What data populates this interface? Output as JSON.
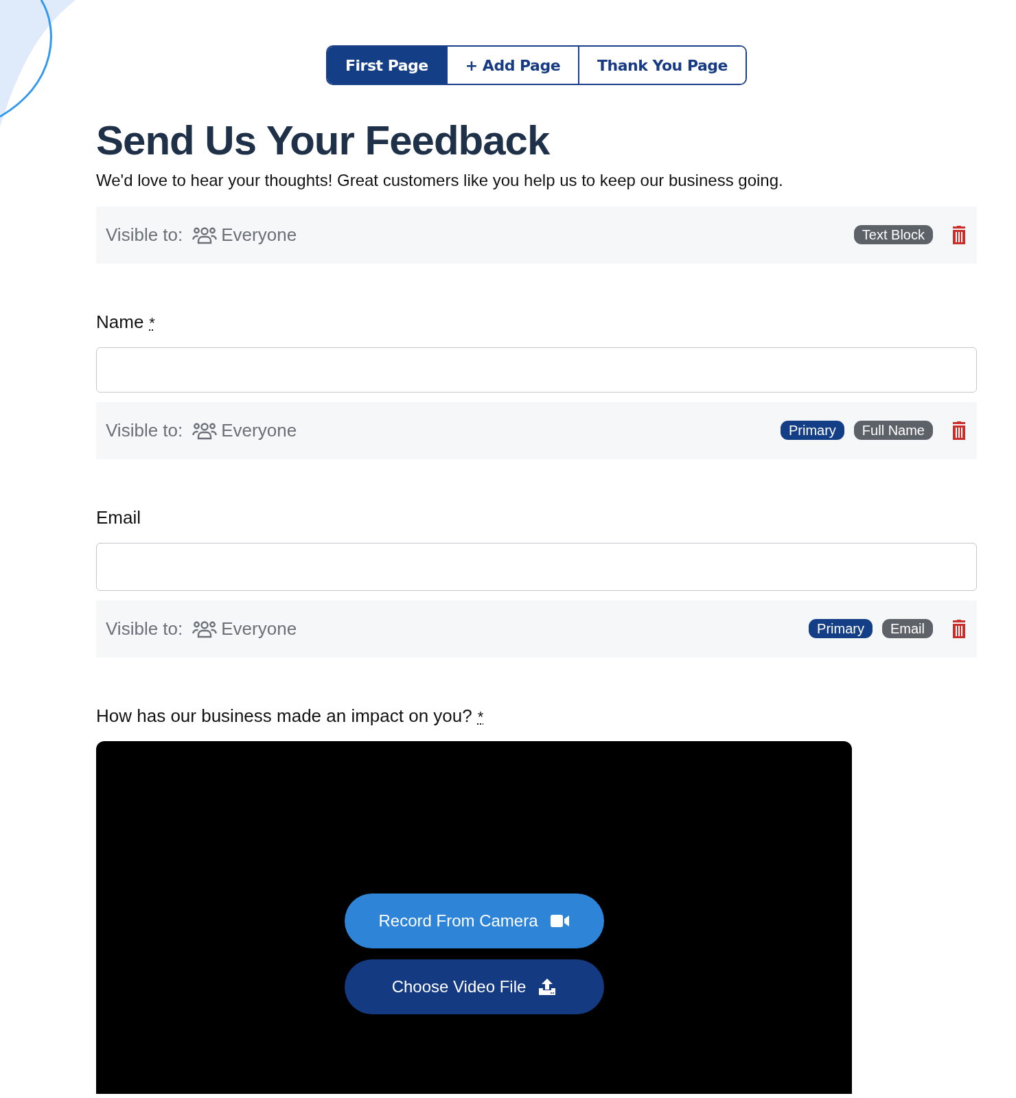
{
  "tabs": [
    {
      "label": "First Page",
      "selected": true
    },
    {
      "label": "+ Add Page",
      "selected": false
    },
    {
      "label": "Thank You Page",
      "selected": false
    }
  ],
  "title": "Send Us Your Feedback",
  "intro": "We'd love to hear your thoughts! Great customers like you help us to keep our business going.",
  "blocks": [
    {
      "kind": "text_block",
      "visibility": {
        "label": "Visible to:",
        "audience": "Everyone"
      },
      "tags": [
        {
          "text": "Text Block",
          "kind": "type"
        }
      ]
    },
    {
      "kind": "input",
      "label": "Name",
      "required_mark": "*",
      "visibility": {
        "label": "Visible to:",
        "audience": "Everyone"
      },
      "tags": [
        {
          "text": "Primary",
          "kind": "primary"
        },
        {
          "text": "Full Name",
          "kind": "type"
        }
      ]
    },
    {
      "kind": "input",
      "label": "Email",
      "visibility": {
        "label": "Visible to:",
        "audience": "Everyone"
      },
      "tags": [
        {
          "text": "Primary",
          "kind": "primary"
        },
        {
          "text": "Email",
          "kind": "type"
        }
      ]
    },
    {
      "kind": "video",
      "label": "How has our business made an impact on you?",
      "required_mark": "*",
      "buttons": [
        {
          "label": "Record From Camera",
          "kind": "record"
        },
        {
          "label": "Choose Video File",
          "kind": "upload"
        }
      ]
    }
  ]
}
